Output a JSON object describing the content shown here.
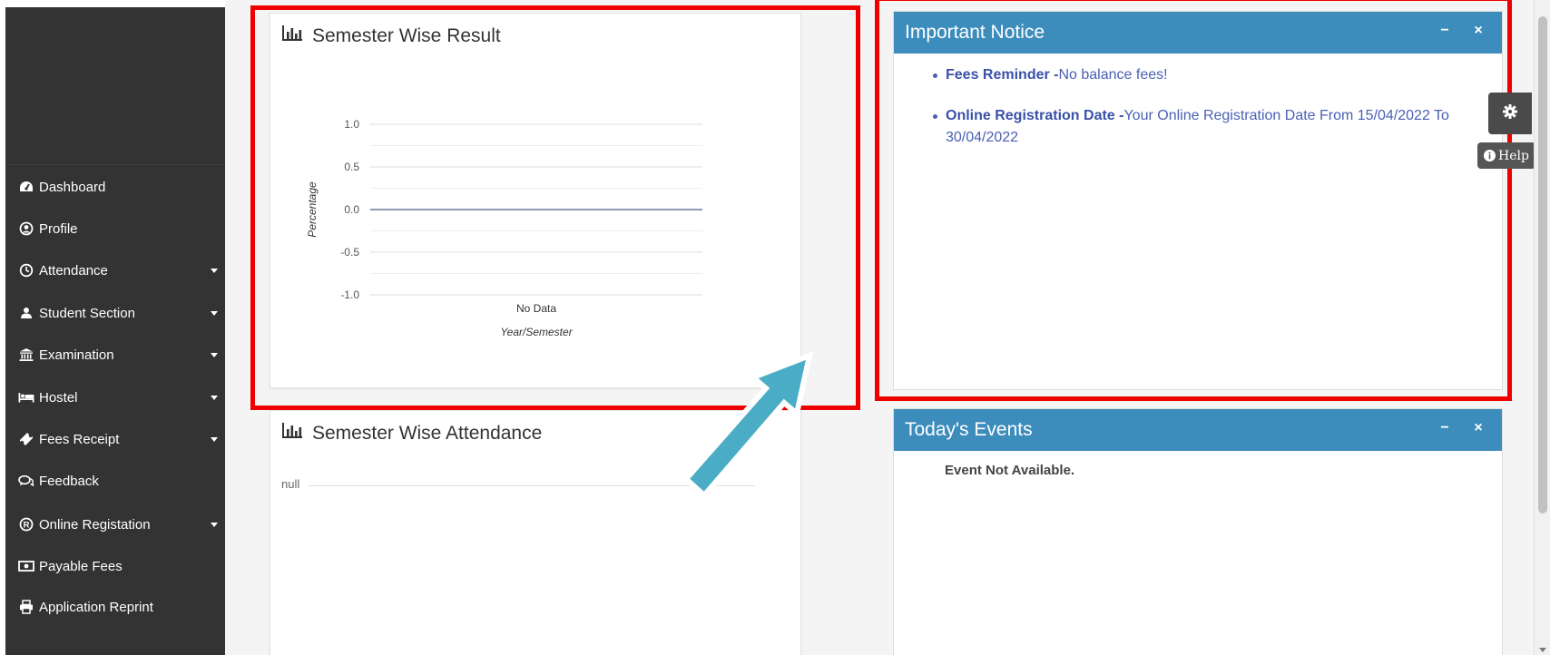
{
  "sidebar": {
    "items": [
      {
        "label": "Dashboard",
        "icon": "tachometer-icon",
        "dropdown": false
      },
      {
        "label": "Profile",
        "icon": "user-circle-icon",
        "dropdown": false
      },
      {
        "label": "Attendance",
        "icon": "clock-icon",
        "dropdown": true
      },
      {
        "label": "Student Section",
        "icon": "user-icon",
        "dropdown": true
      },
      {
        "label": "Examination",
        "icon": "institution-icon",
        "dropdown": true
      },
      {
        "label": "Hostel",
        "icon": "bed-icon",
        "dropdown": true
      },
      {
        "label": "Fees Receipt",
        "icon": "ticket-icon",
        "dropdown": true
      },
      {
        "label": "Feedback",
        "icon": "comments-icon",
        "dropdown": false
      },
      {
        "label": "Online Registation",
        "icon": "registered-icon",
        "dropdown": true
      },
      {
        "label": "Payable Fees",
        "icon": "money-icon",
        "dropdown": false
      },
      {
        "label": "Application Reprint",
        "icon": "print-icon",
        "dropdown": false
      }
    ]
  },
  "result_panel": {
    "title": "Semester Wise Result"
  },
  "attendance_panel": {
    "title": "Semester Wise Attendance",
    "empty_label": "null"
  },
  "notice_panel": {
    "title": "Important Notice",
    "items": [
      {
        "label": "Fees Reminder -",
        "text": "No balance fees!"
      },
      {
        "label": "Online Registration Date -",
        "text": "Your Online Registration Date From 15/04/2022 To 30/04/2022"
      }
    ]
  },
  "events_panel": {
    "title": "Today's Events",
    "message": "Event Not Available."
  },
  "controls": {
    "collapse_symbol": "−",
    "close_symbol": "×",
    "help_label": "Help",
    "settings_icon": "gear-icon"
  },
  "colors": {
    "sidebar_bg": "#333333",
    "box_header": "#3c8dbc",
    "highlight": "#ee0000",
    "arrow": "#4bacc6",
    "notice_text": "#4a60b4"
  },
  "chart_data": {
    "type": "line",
    "categories": [
      "No Data"
    ],
    "series": [
      {
        "values": [
          0
        ]
      }
    ],
    "title": "",
    "xlabel": "Year/Semester",
    "ylabel": "Percentage",
    "ylim": [
      -1.0,
      1.0
    ],
    "yticks": [
      "1.0",
      "0.5",
      "0.0",
      "-0.5",
      "-1.0"
    ],
    "grid": true,
    "legend": "none"
  }
}
